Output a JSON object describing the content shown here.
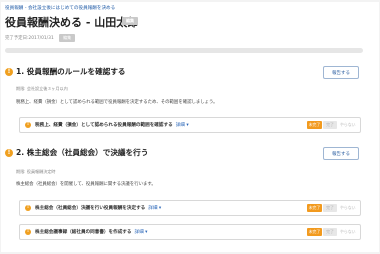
{
  "breadcrumb": "役員報酬 - 会社設立後にはじめての役員報酬を決める",
  "title": "役員報酬決める - 山田太郎",
  "title_badge": "編集",
  "due": "完了予定日:2017/01/31",
  "due_badge": "編集",
  "progress_percent": 0,
  "sections": [
    {
      "number": "1",
      "title": "1. 役員報酬のルールを確認する",
      "button": "報告する",
      "meta": "期限: 会社設立後３ヶ月以内",
      "desc": "税務上、経費（損金）として認められる範囲で役員報酬を決定するため、その範囲を確認しましょう。",
      "tasks": [
        {
          "label": "税務上、経費（損金）として認められる役員報酬の範囲を確認する",
          "link": "詳細 ▾",
          "status": [
            "未完了",
            "完了",
            "やらない"
          ]
        }
      ]
    },
    {
      "number": "2",
      "title": "2. 株主総会（社員総会）で決議を行う",
      "button": "報告する",
      "meta": "期限: 役員報酬決定時",
      "desc": "株主総会（社員総会）を開催して、役員報酬に関する決議を行います。",
      "tasks": [
        {
          "label": "株主総会（社員総会）決議を行い役員報酬を決定する",
          "link": "詳細 ▾",
          "status": [
            "未完了",
            "完了",
            "やらない"
          ]
        },
        {
          "label": "株主総会議事録（総社員の同意書）を作成する",
          "link": "詳細 ▾",
          "status": [
            "未完了",
            "完了",
            "やらない"
          ]
        }
      ]
    }
  ],
  "colors": {
    "accent": "#f0a020",
    "link": "#2a66b8",
    "status_undone": "#f29a1e"
  }
}
